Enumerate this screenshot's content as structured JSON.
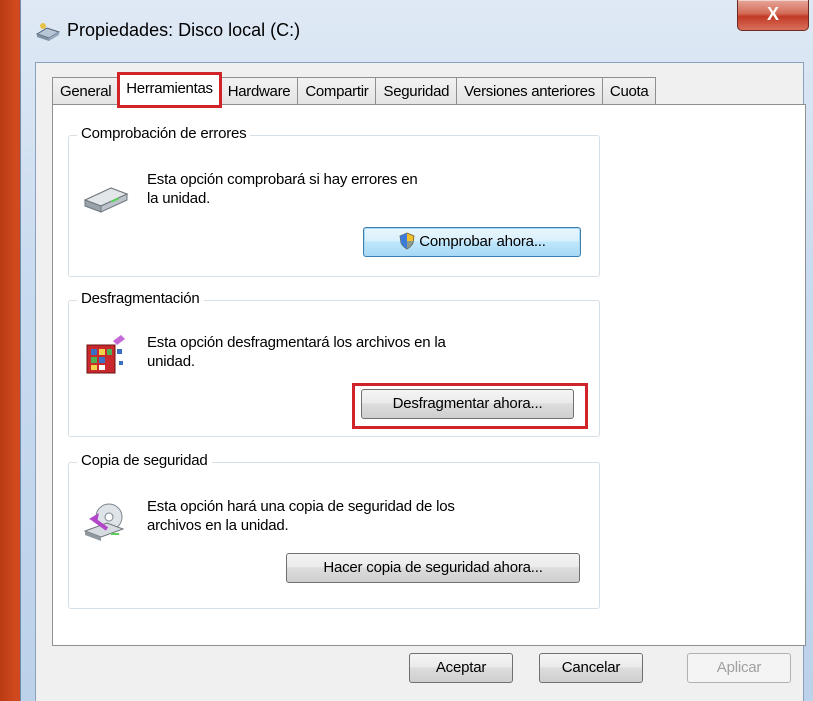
{
  "window": {
    "title": "Propiedades: Disco local (C:)",
    "close_label": "X"
  },
  "tabs": [
    {
      "label": "General"
    },
    {
      "label": "Herramientas"
    },
    {
      "label": "Hardware"
    },
    {
      "label": "Compartir"
    },
    {
      "label": "Seguridad"
    },
    {
      "label": "Versiones anteriores"
    },
    {
      "label": "Cuota"
    }
  ],
  "active_tab": "Herramientas",
  "sections": {
    "error_check": {
      "title": "Comprobación de errores",
      "text_line1": "Esta opción comprobará si hay errores en",
      "text_line2": "la unidad.",
      "button": "Comprobar ahora...",
      "icon": "hard-drive-icon"
    },
    "defrag": {
      "title": "Desfragmentación",
      "text_line1": "Esta opción desfragmentará los archivos en la",
      "text_line2": "unidad.",
      "button": "Desfragmentar ahora...",
      "icon": "defrag-icon"
    },
    "backup": {
      "title": "Copia de seguridad",
      "text_line1": "Esta opción hará una copia de seguridad de los",
      "text_line2": "archivos en la unidad.",
      "button": "Hacer copia de seguridad ahora...",
      "icon": "backup-icon"
    }
  },
  "footer": {
    "ok": "Aceptar",
    "cancel": "Cancelar",
    "apply": "Aplicar"
  },
  "colors": {
    "highlight": "#d1232a",
    "desktop": "#c8431b"
  }
}
